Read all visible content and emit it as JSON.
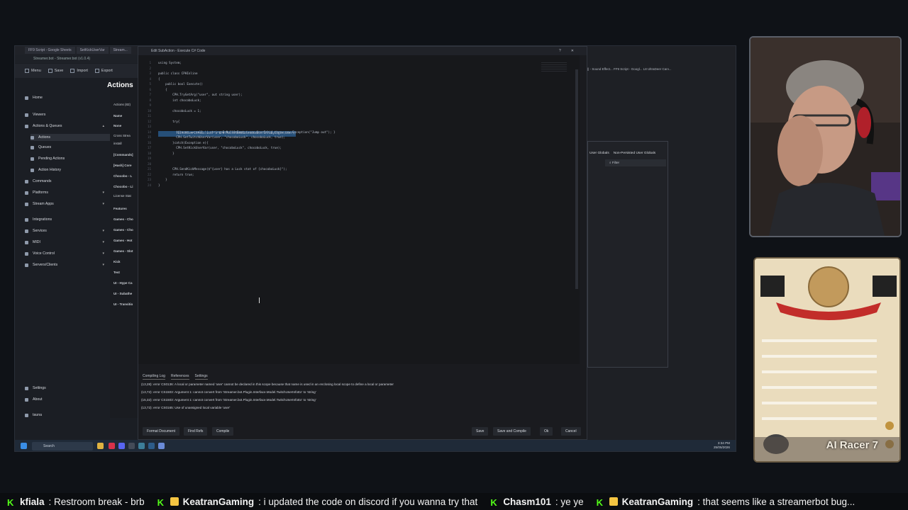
{
  "browser_tabs": [
    "FF9 Script - Google Sheets",
    "SetKickUserVar",
    "Stream..."
  ],
  "streamerbot": {
    "title": "Streamer.bot - Streamer.bot (v1.0.4)",
    "toolbar": {
      "menu": "Menu",
      "save": "Save",
      "import": "Import",
      "export": "Export"
    },
    "nav": [
      {
        "label": "Home"
      },
      {
        "label": "Viewers"
      },
      {
        "label": "Actions & Queues"
      },
      {
        "label": "Actions"
      },
      {
        "label": "Queues"
      },
      {
        "label": "Pending Actions"
      },
      {
        "label": "Action History"
      },
      {
        "label": "Commands"
      },
      {
        "label": "Platforms"
      },
      {
        "label": "Stream Apps"
      },
      {
        "label": "Integrations"
      },
      {
        "label": "Services"
      },
      {
        "label": "MIDI"
      },
      {
        "label": "Voice Control"
      },
      {
        "label": "Servers/Clients"
      },
      {
        "label": "Settings"
      },
      {
        "label": "About"
      },
      {
        "label": "tauna"
      }
    ],
    "actions_title": "Actions",
    "actions_count": "Actions (82)",
    "action_list": [
      "Name",
      "None",
      "Cross Strea",
      "install",
      "[Commands]",
      "[Hash] Core",
      "Chocobo - L",
      "Chocobo - Li",
      "License Stat",
      "Features",
      "Games - Cho",
      "Games - Cho",
      "Games - Hot",
      "Games - Slot",
      "Kick",
      "Test",
      "UI - Hype Ca",
      "UI - Subathe",
      "UI - Transitio"
    ]
  },
  "editor": {
    "title": "Edit SubAction - Execute C# Code",
    "line_numbers": [
      "1",
      "2",
      "3",
      "4",
      "5",
      "6",
      "7",
      "8",
      "9",
      "10",
      "11",
      "12",
      "13",
      "14",
      "15",
      "16",
      "17",
      "18",
      "19",
      "20",
      "21",
      "22",
      "23",
      "24"
    ],
    "code_lines": [
      "using System;",
      "",
      "public class CPHInline",
      "{",
      "    public bool Execute()",
      "    {",
      "        CPH.TryGetArg(\"user\", out string user);",
      "        int chocoboLuck;",
      "",
      "        chocoboLuck = 1;",
      "",
      "        try{",
      "          TwitchUserInfoEx user = CPH.TwitchGetExtendedUserInfoByLogin(user);",
      "          if(user == null || string.IsNullOrEmpty(user.UserId)){ throw new Exception(\"Jump out\"); }",
      "          CPH.SetTwitchUserVar(user, \"chocoboLuck\", chocoboLuck, true);",
      "        }catch(Exception e){",
      "          CPH.SetKickUserVar(user, \"chocoboLuck\", chocoboLuck, true);",
      "        }",
      "",
      "",
      "        CPH.SendKickMessage($\"{user} has a Luck stat of {chocoboLuck}\");",
      "        return true;",
      "    }",
      "}"
    ],
    "log_tabs": [
      "Compiling Log",
      "References",
      "Settings"
    ],
    "log_lines": [
      "(13,28): error CS0136: A local or parameter named 'user' cannot be declared in this scope because that name is used in an enclosing local scope to define a local or parameter",
      "(13,72): error CS1503: Argument 1: cannot convert from 'Streamer.bot.Plugin.Interface.Model.TwitchUserInfoEx' to 'string'",
      "(15,32): error CS1503: Argument 1: cannot convert from 'Streamer.bot.Plugin.Interface.Model.TwitchUserInfoEx' to 'string'",
      "(13,72): error CS0165: Use of unassigned local variable 'user'"
    ],
    "buttons": {
      "format": "Format Document",
      "find_refs": "Find Refs",
      "compile": "Compile",
      "save": "Save",
      "save_compile": "Save and Compile",
      "ok": "Ok",
      "cancel": "Cancel"
    }
  },
  "bg_window": {
    "tabs": "|| - Sound Effect...   FF9 Script - Googl...   L8 UltraDeer Carv...",
    "globals_tabs": [
      "User Globals",
      "Non-Persisted User Globals"
    ],
    "filter": "Filter"
  },
  "taskbar": {
    "search": "Search",
    "tray_lang": "ENG\nUK",
    "time": "3:34 PM",
    "date": "25/05/2026"
  },
  "card": {
    "name": "AI Racer 7"
  },
  "ticker": [
    {
      "user": "kfiala",
      "text": ": Restroom break - brb",
      "badges": [
        "k"
      ]
    },
    {
      "user": "KeatranGaming",
      "text": ": i updated the code on discord if you wanna try that",
      "badges": [
        "k",
        "crown"
      ]
    },
    {
      "user": "Chasm101",
      "text": ": ye ye",
      "badges": [
        "k"
      ]
    },
    {
      "user": "KeatranGaming",
      "text": ": that seems like a streamerbot bug...",
      "badges": [
        "k",
        "crown"
      ]
    }
  ],
  "colors": {
    "kick_green": "#53fc18",
    "editor_bg": "#17181b",
    "selection": "#264f78"
  }
}
